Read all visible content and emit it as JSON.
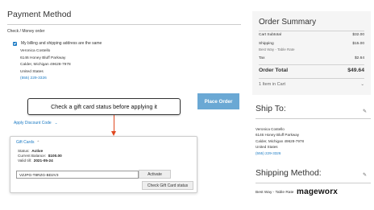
{
  "payment": {
    "title": "Payment Method",
    "method": "Check / Money order",
    "same_address_label": "My billing and shipping address are the same",
    "address": {
      "name": "Veronica Costello",
      "street": "6146 Honey Bluff Parkway",
      "city": "Calder, Michigan 49628-7978",
      "country": "United States",
      "phone": "(555) 229-3326"
    },
    "place_order_label": "Place Order",
    "discount_label": "Apply Discount Code",
    "button_color": "#6aa8d4"
  },
  "callout": {
    "text": "Check a gift card status before applying it",
    "arrow_color": "#e0471f"
  },
  "gift_cards": {
    "title": "Gift Cards",
    "status_label": "Status:",
    "status_value": "Active",
    "balance_label": "Current Balance:",
    "balance_value": "$100.00",
    "valid_label": "Valid till:",
    "valid_value": "2021-05-24",
    "code_value": "VZJPG-T8RZG-BD2V3",
    "activate_label": "Activate",
    "check_label": "Check Gift Card status"
  },
  "summary": {
    "title": "Order Summary",
    "cart_subtotal_label": "Cart Subtotal",
    "cart_subtotal_value": "$32.00",
    "shipping_label": "Shipping",
    "shipping_value": "$15.00",
    "shipping_method": "Best Way - Table Rate",
    "tax_label": "Tax",
    "tax_value": "$2.64",
    "order_total_label": "Order Total",
    "order_total_value": "$49.64",
    "items_label": "1 Item in Cart"
  },
  "ship_to": {
    "title": "Ship To:",
    "name": "Veronica Costello",
    "street": "6146 Honey Bluff Parkway",
    "city": "Calder, Michigan 49628-7978",
    "country": "United States",
    "phone": "(555) 229-3326"
  },
  "shipping_method": {
    "title": "Shipping Method:",
    "value": "Best Way - Table Rate"
  },
  "brand": {
    "name": "mageworx"
  },
  "accent_color": "#1979c3"
}
